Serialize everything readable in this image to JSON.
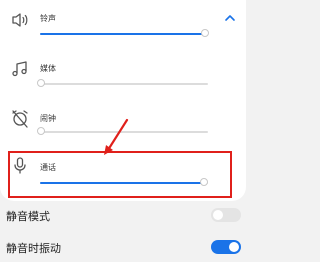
{
  "volume_panel": {
    "rows": [
      {
        "label": "铃声",
        "icon": "speaker-icon",
        "level": 0.99
      },
      {
        "label": "媒体",
        "icon": "music-note-icon",
        "level": 0.0
      },
      {
        "label": "闹钟",
        "icon": "alarm-off-icon",
        "level": 0.0
      },
      {
        "label": "通话",
        "icon": "microphone-icon",
        "level": 0.98
      }
    ],
    "collapse_icon": "chevron-up-icon",
    "highlighted_row": "通话"
  },
  "settings": [
    {
      "label": "静音模式",
      "toggle_on": false
    },
    {
      "label": "静音时振动",
      "toggle_on": true
    }
  ],
  "colors": {
    "accent": "#1a73e8",
    "highlight": "#e0201b",
    "track": "#dcdcdc",
    "background": "#f2f2f2",
    "panel": "#ffffff"
  }
}
